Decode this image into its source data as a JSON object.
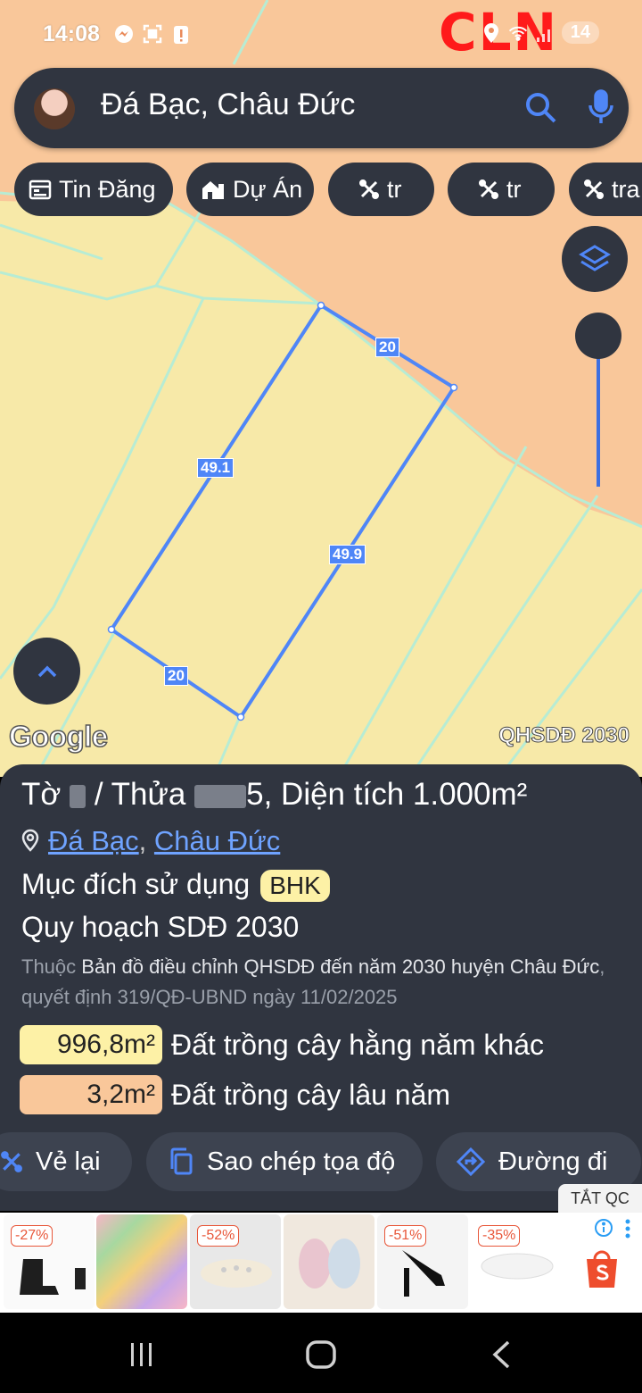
{
  "status_bar": {
    "time": "14:08",
    "battery": "14",
    "icons": [
      "messenger-icon",
      "screenshot-icon",
      "alert-icon",
      "location-icon",
      "wifi-icon",
      "signal-icon"
    ]
  },
  "map": {
    "zone_code": "CLN",
    "edge_labels": {
      "top": "20",
      "left": "49.1",
      "right": "49.9",
      "bottom": "20"
    },
    "google_label": "Google",
    "plan_label": "QHSDĐ 2030",
    "colors": {
      "parcel_fill": "#f7e9a8",
      "zone_fill": "#f9c79a",
      "boundary": "#4f86f7",
      "grid": "#b7ecd4"
    }
  },
  "search": {
    "value": "Đá Bạc, Châu Đức"
  },
  "chips": [
    {
      "label": "Tin Đăng",
      "icon": "calendar-icon"
    },
    {
      "label": "Dự Án",
      "icon": "house-icon"
    },
    {
      "label": "tr",
      "icon": "tools-icon"
    },
    {
      "label": "tr",
      "icon": "tools-icon"
    },
    {
      "label": "tra",
      "icon": "tools-icon"
    }
  ],
  "parcel": {
    "title_prefix": "Tờ",
    "title_to_tail": "/",
    "title_thua": "Thửa",
    "title_thua_tail": "5, Diện tích",
    "area": "1.000m²",
    "location_commune": "Đá Bạc",
    "location_sep": ",",
    "location_district": "Châu Đức",
    "purpose_label": "Mục đích sử dụng",
    "purpose_code": "BHK",
    "plan_title": "Quy hoạch SDĐ 2030",
    "desc_prefix": "Thuộc",
    "desc_link": "Bản đồ điều chỉnh QHSDĐ đến năm 2030 huyện Châu Đức",
    "desc_suffix": ", quyết định 319/QĐ-UBND ngày 11/02/2025",
    "areas": [
      {
        "value": "996,8m²",
        "label": "Đất trồng cây hằng năm khác",
        "color": "#fdf1a6"
      },
      {
        "value": "3,2m²",
        "label": "Đất trồng cây lâu năm",
        "color": "#f9c79a"
      }
    ]
  },
  "actions": [
    {
      "label": "Vẻ lại",
      "icon": "redraw-icon"
    },
    {
      "label": "Sao chép tọa độ",
      "icon": "copy-icon"
    },
    {
      "label": "Đường đi",
      "icon": "directions-icon"
    }
  ],
  "ad": {
    "close_label": "TẮT QC",
    "discounts": [
      "-27%",
      "-52%",
      "-51%",
      "-35%"
    ]
  }
}
